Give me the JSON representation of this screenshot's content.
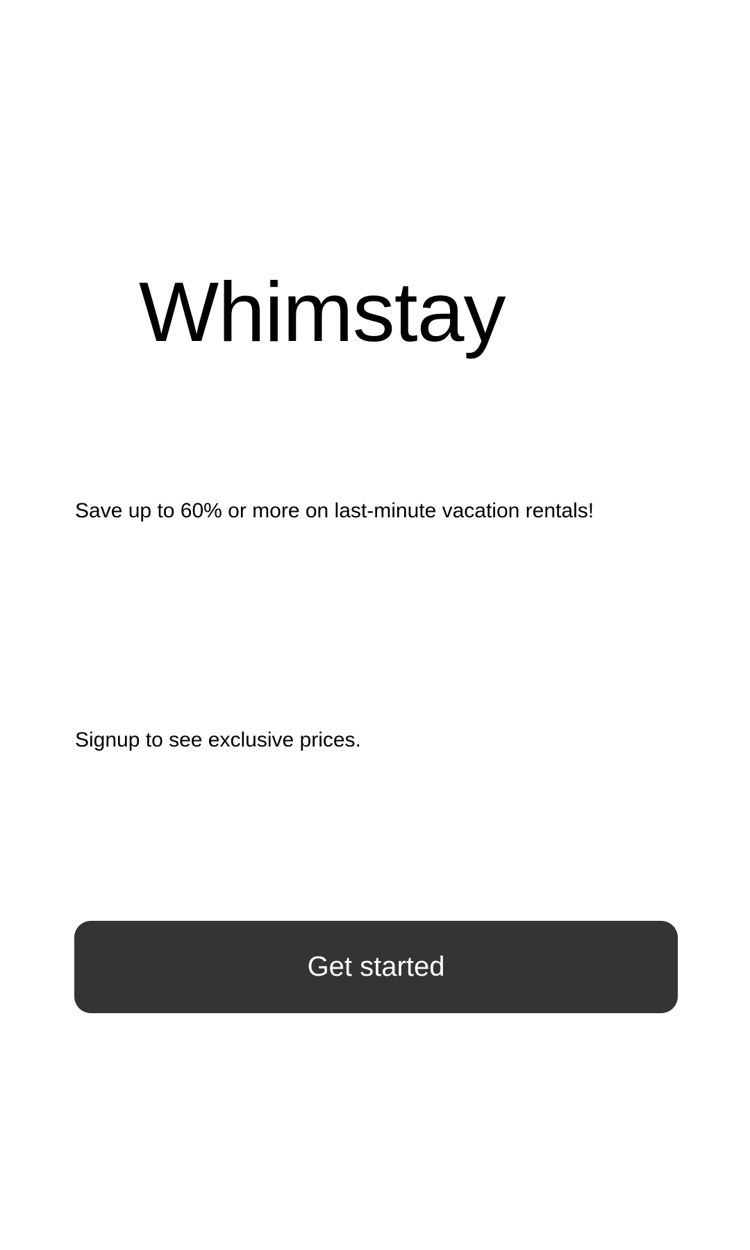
{
  "app": {
    "title": "Whimstay"
  },
  "onboarding": {
    "tagline": "Save up to 60% or more on last-minute vacation rentals!",
    "subtitle": "Signup to see exclusive prices.",
    "cta_label": "Get started"
  },
  "colors": {
    "background": "#ffffff",
    "text": "#000000",
    "button_background": "#343434",
    "button_text": "#ffffff"
  }
}
